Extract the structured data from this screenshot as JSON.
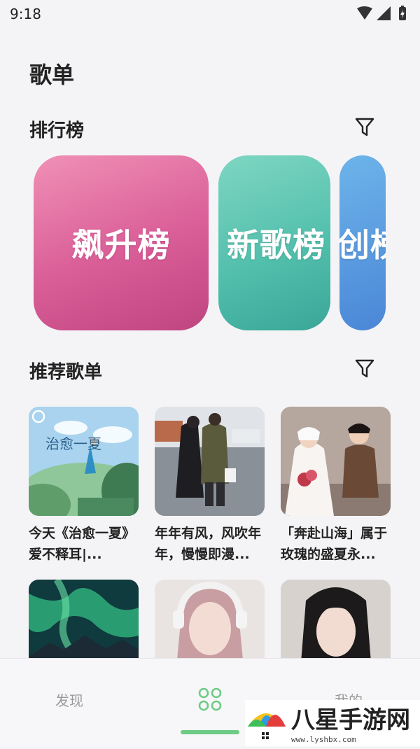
{
  "status_bar": {
    "time": "9:18"
  },
  "page": {
    "title": "歌单"
  },
  "ranking": {
    "title": "排行榜",
    "cards": [
      {
        "label": "飙升榜",
        "color": "#d95d97"
      },
      {
        "label": "新歌榜",
        "color": "#53c0ad"
      },
      {
        "label": "原创榜",
        "color": "#5a9be0"
      }
    ]
  },
  "recommended": {
    "title": "推荐歌单",
    "playlists": [
      {
        "title": "今天《治愈一夏》爱不释耳|..."
      },
      {
        "title": "年年有风，风吹年年，慢慢即漫..."
      },
      {
        "title": "「奔赴山海」属于玫瑰的盛夏永..."
      },
      {
        "title": ""
      },
      {
        "title": ""
      },
      {
        "title": ""
      }
    ]
  },
  "cover_art": {
    "text": "治愈一夏"
  },
  "bottom_nav": {
    "items": [
      {
        "label": "发现",
        "icon": "compass"
      },
      {
        "label": "",
        "icon": "grid-icon"
      },
      {
        "label": "我的",
        "icon": "profile"
      }
    ],
    "active_color": "#6ecb85"
  },
  "watermark": {
    "text": "八星手游网",
    "url": "www.lyshbx.com"
  }
}
